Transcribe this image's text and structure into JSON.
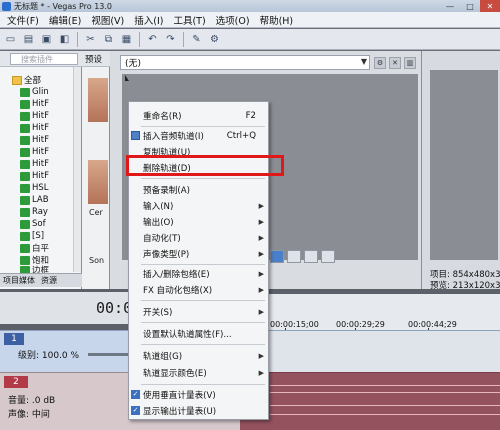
{
  "window": {
    "title": "无标题 * - Vegas Pro 13.0",
    "controls": [
      "—",
      "□",
      "✕"
    ]
  },
  "menubar": [
    "文件(F)",
    "编辑(E)",
    "视图(V)",
    "插入(I)",
    "工具(T)",
    "选项(O)",
    "帮助(H)"
  ],
  "toolbar_icons": [
    "new-icon",
    "open-icon",
    "save-icon",
    "properties-icon",
    "cut-icon",
    "copy-icon",
    "paste-icon",
    "undo-icon",
    "redo-icon",
    "render-icon",
    "tool-icon"
  ],
  "explorer": {
    "search_placeholder": "搜索插件",
    "root": "全部",
    "items": [
      "Glin",
      "HitF",
      "HitF",
      "HitF",
      "HitF",
      "HitF",
      "HitF",
      "HitF",
      "HSL",
      "LAB",
      "Ray",
      "Sof",
      "[S]",
      "白平",
      "饱和",
      "边框"
    ],
    "tabs": [
      "项目媒体",
      "资源"
    ]
  },
  "thumbs": {
    "header": "预设",
    "labels": [
      "Cer",
      "Son"
    ]
  },
  "preview": {
    "dropdown_value": "(无)"
  },
  "properties": {
    "project_label": "项目: 854x480x3",
    "preview_label": "预览: 213x120x3"
  },
  "timeline": {
    "timecode": "00:0",
    "ruler": [
      "00:00:15;00",
      "00:00:29;29",
      "00:00:44;29"
    ],
    "track1": {
      "number": "1",
      "level": "级别: 100.0 %"
    },
    "track2": {
      "number": "2",
      "volume": "音量:   .0 dB",
      "pan": "声像:     中间"
    }
  },
  "context_menu": {
    "items": [
      {
        "label": "重命名(R)",
        "shortcut": "F2",
        "submenu": false,
        "icon": ""
      },
      {
        "label": "插入音频轨道(I)",
        "shortcut": "Ctrl+Q",
        "submenu": false,
        "icon": "insert-audio-track-icon"
      },
      {
        "label": "复制轨道(U)",
        "shortcut": "",
        "submenu": false,
        "icon": ""
      },
      {
        "label": "删除轨道(D)",
        "shortcut": "",
        "submenu": false,
        "icon": ""
      },
      {
        "label": "预备录制(A)",
        "shortcut": "",
        "submenu": false,
        "icon": ""
      },
      {
        "label": "输入(N)",
        "shortcut": "",
        "submenu": true,
        "icon": ""
      },
      {
        "label": "输出(O)",
        "shortcut": "",
        "submenu": true,
        "icon": ""
      },
      {
        "label": "自动化(T)",
        "shortcut": "",
        "submenu": true,
        "icon": ""
      },
      {
        "label": "声像类型(P)",
        "shortcut": "",
        "submenu": true,
        "icon": ""
      },
      {
        "label": "插入/删除包络(E)",
        "shortcut": "",
        "submenu": true,
        "icon": ""
      },
      {
        "label": "FX 自动化包络(X)",
        "shortcut": "",
        "submenu": true,
        "icon": ""
      },
      {
        "label": "开关(S)",
        "shortcut": "",
        "submenu": true,
        "icon": ""
      },
      {
        "label": "设置默认轨道属性(F)...",
        "shortcut": "",
        "submenu": false,
        "icon": ""
      },
      {
        "label": "轨道组(G)",
        "shortcut": "",
        "submenu": true,
        "icon": ""
      },
      {
        "label": "轨道显示颜色(E)",
        "shortcut": "",
        "submenu": true,
        "icon": ""
      },
      {
        "label": "使用垂直计量表(V)",
        "shortcut": "",
        "submenu": false,
        "icon": "check"
      },
      {
        "label": "显示输出计量表(U)",
        "shortcut": "",
        "submenu": false,
        "icon": "check"
      }
    ],
    "highlight_color": "#e11818"
  }
}
